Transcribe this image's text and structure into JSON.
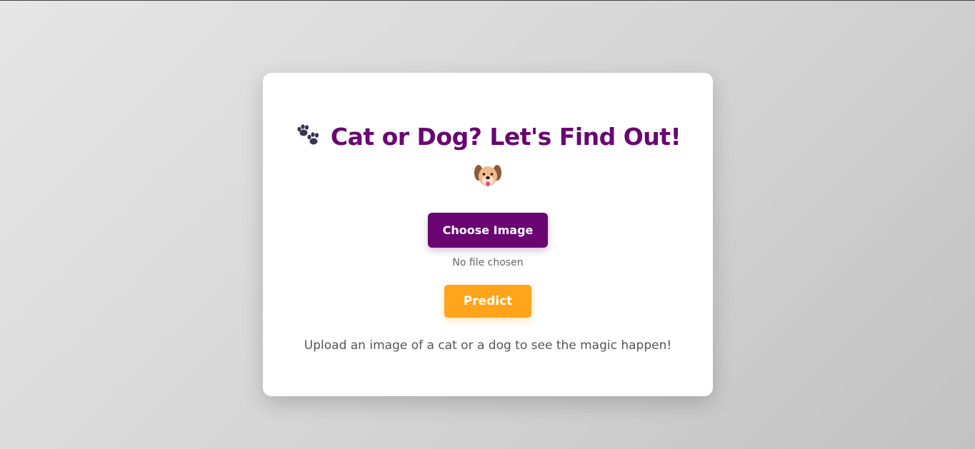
{
  "app": {
    "title": "Cat or Dog? Let's Find Out!",
    "title_icon": "paw-prints-icon",
    "subtitle_icon": "dog-face-icon"
  },
  "upload": {
    "choose_label": "Choose Image",
    "file_status": "No file chosen"
  },
  "actions": {
    "predict_label": "Predict"
  },
  "description": "Upload an image of a cat or a dog to see the magic happen!",
  "colors": {
    "primary": "#6a0572",
    "accent": "#ffa41b",
    "card": "#ffffff",
    "background": "#d6d6d6"
  }
}
